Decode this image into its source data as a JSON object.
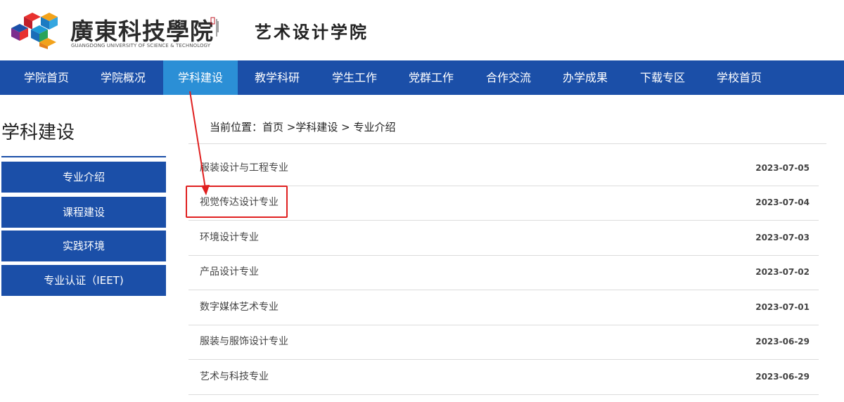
{
  "header": {
    "university_cn": "廣東科技學院",
    "university_en": "GUANGDONG UNIVERSITY OF SCIENCE & TECHNOLOGY",
    "school_name": "艺术设计学院"
  },
  "nav": {
    "active_index": 2,
    "items": [
      {
        "label": "学院首页"
      },
      {
        "label": "学院概况"
      },
      {
        "label": "学科建设"
      },
      {
        "label": "教学科研"
      },
      {
        "label": "学生工作"
      },
      {
        "label": "党群工作"
      },
      {
        "label": "合作交流"
      },
      {
        "label": "办学成果"
      },
      {
        "label": "下载专区"
      },
      {
        "label": "学校首页"
      }
    ]
  },
  "sidebar": {
    "title": "学科建设",
    "items": [
      {
        "label": "专业介绍"
      },
      {
        "label": "课程建设"
      },
      {
        "label": "实践环境"
      },
      {
        "label": "专业认证（IEET)"
      }
    ]
  },
  "breadcrumb": {
    "text": "当前位置：首页 >学科建设 > 专业介绍"
  },
  "articles": [
    {
      "title": "服装设计与工程专业",
      "date": "2023-07-05"
    },
    {
      "title": "视觉传达设计专业",
      "date": "2023-07-04"
    },
    {
      "title": "环境设计专业",
      "date": "2023-07-03"
    },
    {
      "title": "产品设计专业",
      "date": "2023-07-02"
    },
    {
      "title": "数字媒体艺术专业",
      "date": "2023-07-01"
    },
    {
      "title": "服装与服饰设计专业",
      "date": "2023-06-29"
    },
    {
      "title": "艺术与科技专业",
      "date": "2023-06-29"
    }
  ],
  "colors": {
    "nav_bg": "#1b4fa8",
    "nav_active": "#2b8fd6",
    "annotation": "#e02020"
  }
}
